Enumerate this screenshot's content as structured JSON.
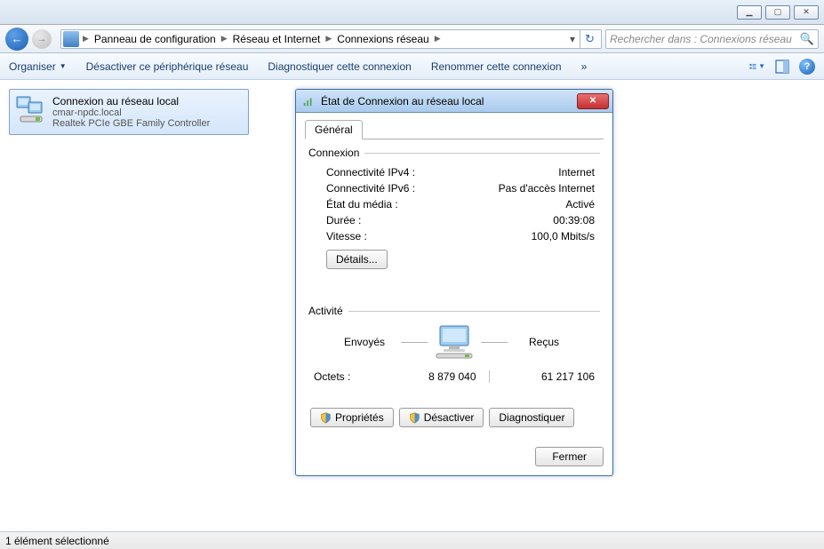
{
  "window_controls": {
    "min": "▁",
    "max": "▢",
    "close": "✕"
  },
  "breadcrumb": {
    "items": [
      "Panneau de configuration",
      "Réseau et Internet",
      "Connexions réseau"
    ]
  },
  "search": {
    "placeholder": "Rechercher dans : Connexions réseau"
  },
  "toolbar": {
    "organize": "Organiser",
    "disable_device": "Désactiver ce périphérique réseau",
    "diagnose": "Diagnostiquer cette connexion",
    "rename": "Renommer cette connexion",
    "overflow": "»"
  },
  "connection_item": {
    "name": "Connexion au réseau local",
    "domain": "cmar-npdc.local",
    "adapter": "Realtek PCIe GBE Family Controller"
  },
  "dialog": {
    "title": "État de Connexion au réseau local",
    "tab_general": "Général",
    "group_connection": "Connexion",
    "ipv4_label": "Connectivité IPv4 :",
    "ipv4_value": "Internet",
    "ipv6_label": "Connectivité IPv6 :",
    "ipv6_value": "Pas d'accès Internet",
    "media_label": "État du média :",
    "media_value": "Activé",
    "duration_label": "Durée :",
    "duration_value": "00:39:08",
    "speed_label": "Vitesse :",
    "speed_value": "100,0 Mbits/s",
    "details_btn": "Détails...",
    "group_activity": "Activité",
    "sent_label": "Envoyés",
    "recv_label": "Reçus",
    "bytes_label": "Octets :",
    "bytes_sent": "8 879 040",
    "bytes_recv": "61 217 106",
    "properties_btn": "Propriétés",
    "disable_btn": "Désactiver",
    "diagnose_btn": "Diagnostiquer",
    "close_btn": "Fermer"
  },
  "statusbar": {
    "text": "1 élément sélectionné"
  }
}
